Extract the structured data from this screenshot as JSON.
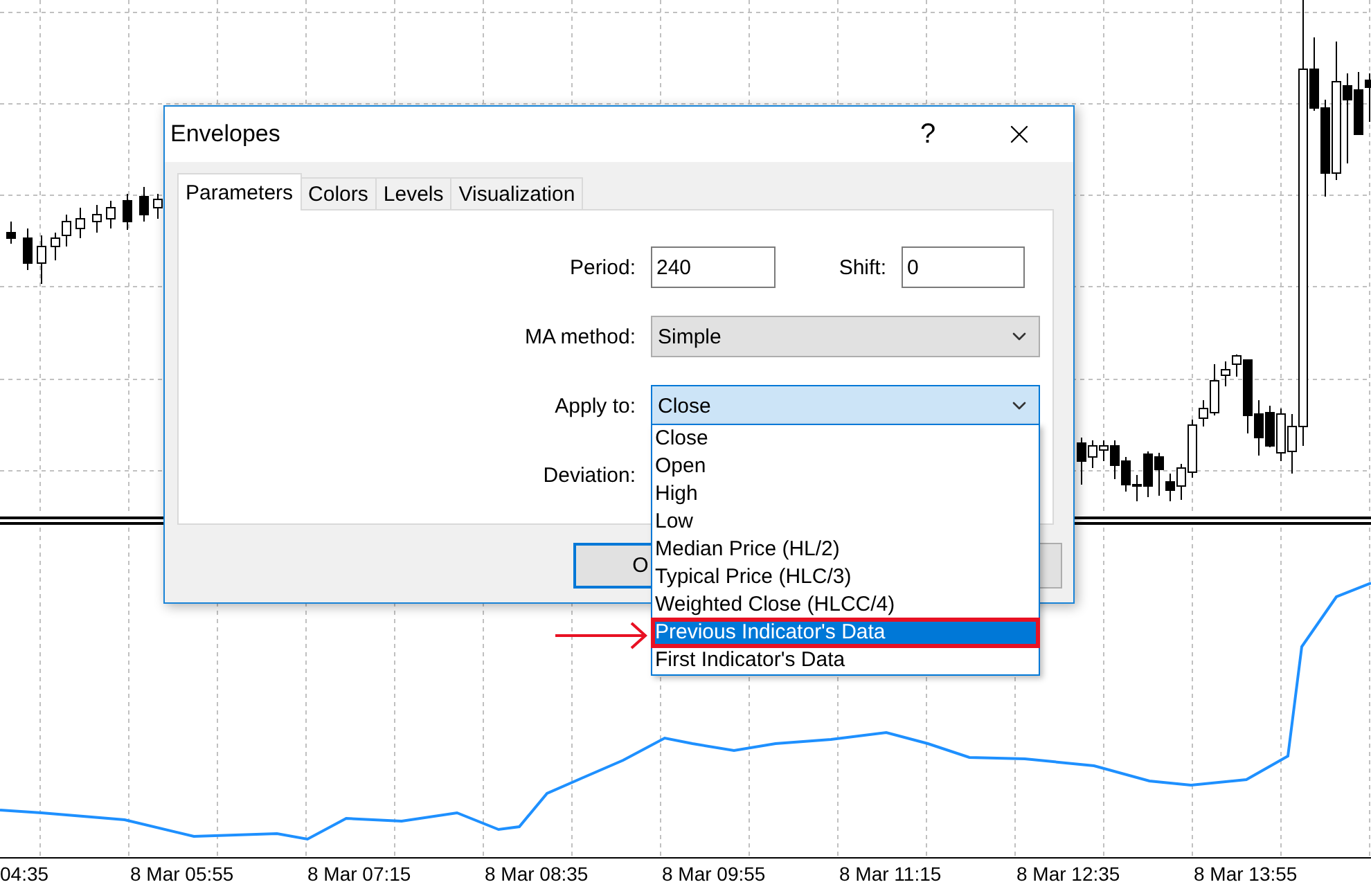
{
  "window": {
    "title": "Envelopes",
    "help": "?"
  },
  "tabs": [
    {
      "label": "Parameters",
      "selected": true
    },
    {
      "label": "Colors",
      "selected": false
    },
    {
      "label": "Levels",
      "selected": false
    },
    {
      "label": "Visualization",
      "selected": false
    }
  ],
  "parameters": {
    "period": {
      "label": "Period:",
      "value": "240"
    },
    "shift": {
      "label": "Shift:",
      "value": "0"
    },
    "ma_method": {
      "label": "MA method:",
      "value": "Simple"
    },
    "apply_to": {
      "label": "Apply to:",
      "value": "Close",
      "expanded": true,
      "options": [
        {
          "label": "Close",
          "highlighted": false
        },
        {
          "label": "Open",
          "highlighted": false
        },
        {
          "label": "High",
          "highlighted": false
        },
        {
          "label": "Low",
          "highlighted": false
        },
        {
          "label": "Median Price (HL/2)",
          "highlighted": false
        },
        {
          "label": "Typical Price (HLC/3)",
          "highlighted": false
        },
        {
          "label": "Weighted Close (HLCC/4)",
          "highlighted": false
        },
        {
          "label": "Previous Indicator's Data",
          "highlighted": true
        },
        {
          "label": "First Indicator's Data",
          "highlighted": false
        }
      ]
    },
    "deviation": {
      "label": "Deviation:"
    }
  },
  "buttons": [
    "O"
  ],
  "chart": {
    "time_labels": [
      "04:35",
      "8 Mar 05:55",
      "8 Mar 07:15",
      "8 Mar 08:35",
      "8 Mar 09:55",
      "8 Mar 11:15",
      "8 Mar 12:35",
      "8 Mar 13:55"
    ]
  }
}
